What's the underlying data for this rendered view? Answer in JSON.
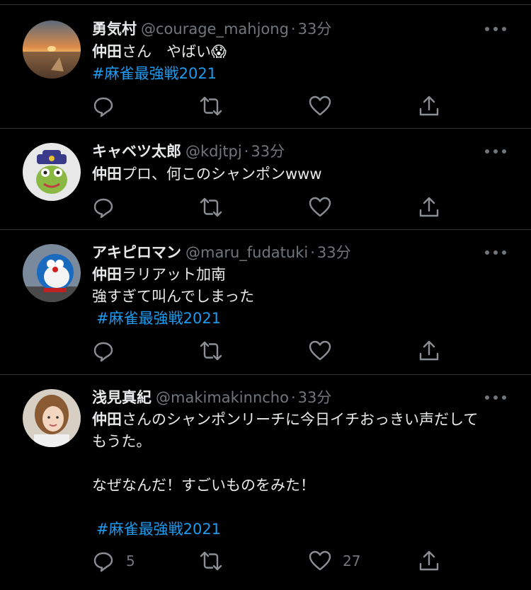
{
  "tweets": [
    {
      "name": "勇気村",
      "handle": "@courage_mahjong",
      "time": "33分",
      "bold_prefix": "仲田",
      "text_lines": [
        "さん　やばい😱"
      ],
      "hashtag": "#麻雀最強戦2021",
      "reply_count": "",
      "like_count": ""
    },
    {
      "name": "キャベツ太郎",
      "handle": "@kdjtpj",
      "time": "33分",
      "bold_prefix": "仲田",
      "text_lines": [
        "プロ、何このシャンポンwww"
      ],
      "hashtag": "",
      "reply_count": "",
      "like_count": ""
    },
    {
      "name": "アキピロマン",
      "handle": "@maru_fudatuki",
      "time": "33分",
      "bold_prefix": "仲田",
      "text_lines": [
        "ラリアット加南",
        "強すぎて叫んでしまった"
      ],
      "hashtag": "#麻雀最強戦2021",
      "reply_count": "",
      "like_count": ""
    },
    {
      "name": "浅見真紀",
      "handle": "@makimakinncho",
      "time": "33分",
      "bold_prefix": "仲田",
      "text_lines": [
        "さんのシャンポンリーチに今日イチおっきい声だして",
        "もうた。",
        "",
        "なぜなんだ！すごいものをみた！",
        ""
      ],
      "hashtag": "#麻雀最強戦2021",
      "reply_count": "5",
      "like_count": "27"
    }
  ],
  "colors": {
    "background": "#000000",
    "secondary_text": "#71767b",
    "hashtag": "#1d9bf0",
    "divider": "#2f3336"
  }
}
